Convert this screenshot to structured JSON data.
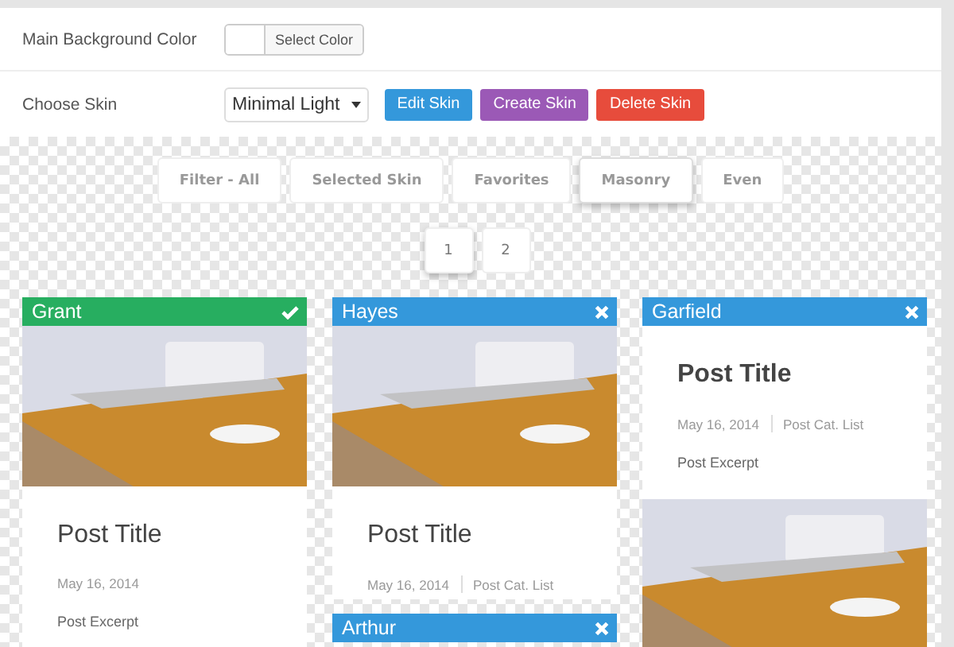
{
  "settings": [
    {
      "kind": "color",
      "label": "Main Background Color",
      "button": "Select Color"
    },
    {
      "kind": "skin",
      "label": "Choose Skin",
      "select": "Minimal Light",
      "buttons": [
        {
          "label": "Edit Skin",
          "color": "#3498db"
        },
        {
          "label": "Create Skin",
          "color": "#9b59b6"
        },
        {
          "label": "Delete Skin",
          "color": "#e74c3c"
        }
      ]
    }
  ],
  "filters": [
    {
      "label": "Filter - All",
      "selected": false
    },
    {
      "label": "Selected Skin",
      "selected": false
    },
    {
      "label": "Favorites",
      "selected": false
    },
    {
      "label": "Masonry",
      "selected": true
    },
    {
      "label": "Even",
      "selected": false
    }
  ],
  "pages": [
    {
      "label": "1",
      "selected": true
    },
    {
      "label": "2",
      "selected": false
    }
  ],
  "columns": [
    [
      {
        "name": "Grant",
        "color": "#27ae60",
        "checked": true,
        "kind": "image_top",
        "title": "Post Title",
        "date": "May 16, 2014",
        "excerpt": "Post Excerpt"
      }
    ],
    [
      {
        "name": "Hayes",
        "color": "#3498db",
        "checked": false,
        "kind": "image_top",
        "title": "Post Title",
        "date": "May 16, 2014",
        "category": "Post Cat. List"
      },
      {
        "name": "Arthur",
        "color": "#3498db",
        "checked": false,
        "kind": "header_only"
      }
    ],
    [
      {
        "name": "Garfield",
        "color": "#3498db",
        "checked": false,
        "kind": "text_top",
        "title": "Post Title",
        "date": "May 16, 2014",
        "category": "Post Cat. List",
        "excerpt": "Post Excerpt"
      }
    ]
  ]
}
